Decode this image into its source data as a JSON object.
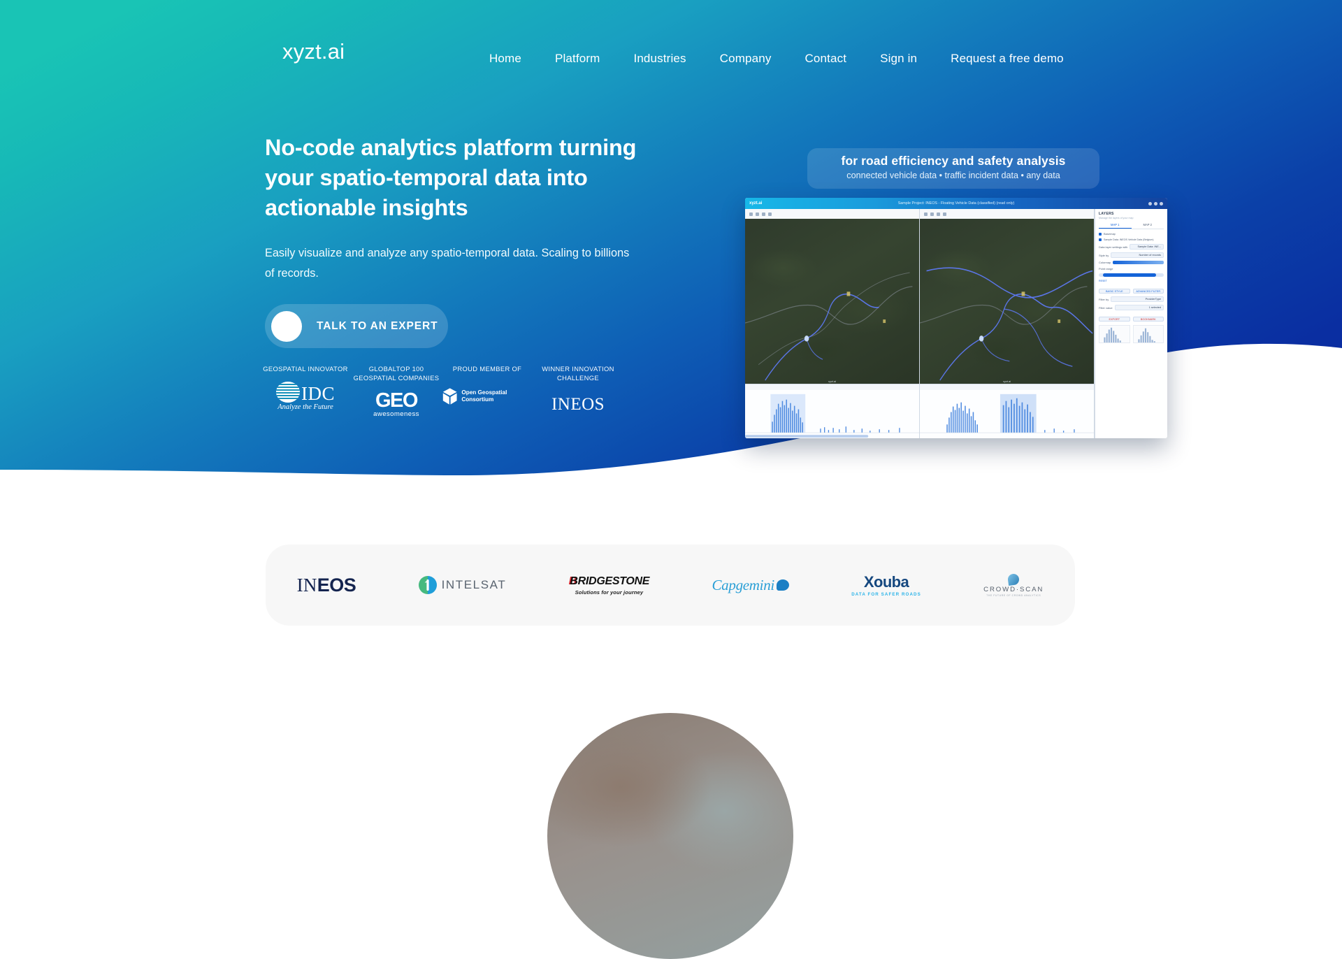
{
  "brand": {
    "logo_text": "xyzt.ai"
  },
  "nav": {
    "items": [
      {
        "label": "Home"
      },
      {
        "label": "Platform"
      },
      {
        "label": "Industries"
      },
      {
        "label": "Company"
      },
      {
        "label": "Contact"
      },
      {
        "label": "Sign in"
      },
      {
        "label": "Request a free demo"
      }
    ]
  },
  "hero": {
    "headline": "No-code analytics platform turning your spatio-temporal data into actionable insights",
    "subcopy": "Easily visualize and analyze any spatio-temporal data. Scaling to billions of records.",
    "cta_label": "TALK TO AN EXPERT",
    "gradient_start": "#18c2b6",
    "gradient_end": "#0c2ba0"
  },
  "awards": [
    {
      "caption": "GEOSPATIAL INNOVATOR",
      "brand": "IDC",
      "tagline": "Analyze the Future"
    },
    {
      "caption": "GLOBALTOP 100 GEOSPATIAL COMPANIES",
      "brand": "GEO",
      "tagline": "awesomeness"
    },
    {
      "caption": "PROUD MEMBER OF",
      "brand": "Open Geospatial Consortium",
      "tagline": ""
    },
    {
      "caption": "WINNER INNOVATION CHALLENGE",
      "brand": "INEOS",
      "tagline": ""
    }
  ],
  "callout": {
    "title": "for road efficiency and safety analysis",
    "subtitle": "connected vehicle data • traffic incident data • any data"
  },
  "screenshot": {
    "app_logo": "xyzt.ai",
    "window_title": "Sample Project: INEOS - Floating Vehicle Data (classified) (read only)",
    "panel_title": "LAYERS",
    "panel_subtitle": "Manage the layers of your map",
    "tabs": [
      {
        "label": "MAP 1",
        "active": true
      },
      {
        "label": "MAP 2",
        "active": false
      }
    ],
    "layers": [
      {
        "label": "Basemap"
      },
      {
        "label": "Sample Data: INEOS Vehicle Data (Belgium)"
      }
    ],
    "fields": [
      {
        "label": "Data layer settings with",
        "value": "Sample Data: INE..."
      },
      {
        "label": "Style by",
        "value": "Number of records"
      },
      {
        "label": "Colormap",
        "value": ""
      },
      {
        "label": "Point range",
        "value": ""
      },
      {
        "label": "Filter by",
        "value": "ProviderType"
      },
      {
        "label": "Filter value",
        "value": "1 selected"
      }
    ],
    "buttons": [
      {
        "label": "BASIC STYLE"
      },
      {
        "label": "ADVANCED FILTER"
      },
      {
        "label": "EXPORT"
      },
      {
        "label": "BOOKMARK"
      }
    ],
    "map_attribution": "xyzt.ai",
    "reset_link": "RESET"
  },
  "clients": {
    "logos": [
      {
        "name": "INEOS",
        "prefix": "IN",
        "suffix": "EOS"
      },
      {
        "name": "INTELSAT",
        "text": "INTELSAT"
      },
      {
        "name": "BRIDGESTONE",
        "text": "BRIDGESTONE",
        "tagline": "Solutions for your journey"
      },
      {
        "name": "Capgemini",
        "text": "Capgemini"
      },
      {
        "name": "Xouba",
        "text": "Xouba",
        "tagline": "DATA FOR SAFER ROADS"
      },
      {
        "name": "CROWD-SCAN",
        "text": "CROWD·SCAN",
        "tagline": "THE FUTURE OF CROWD ANALYTICS"
      }
    ]
  }
}
